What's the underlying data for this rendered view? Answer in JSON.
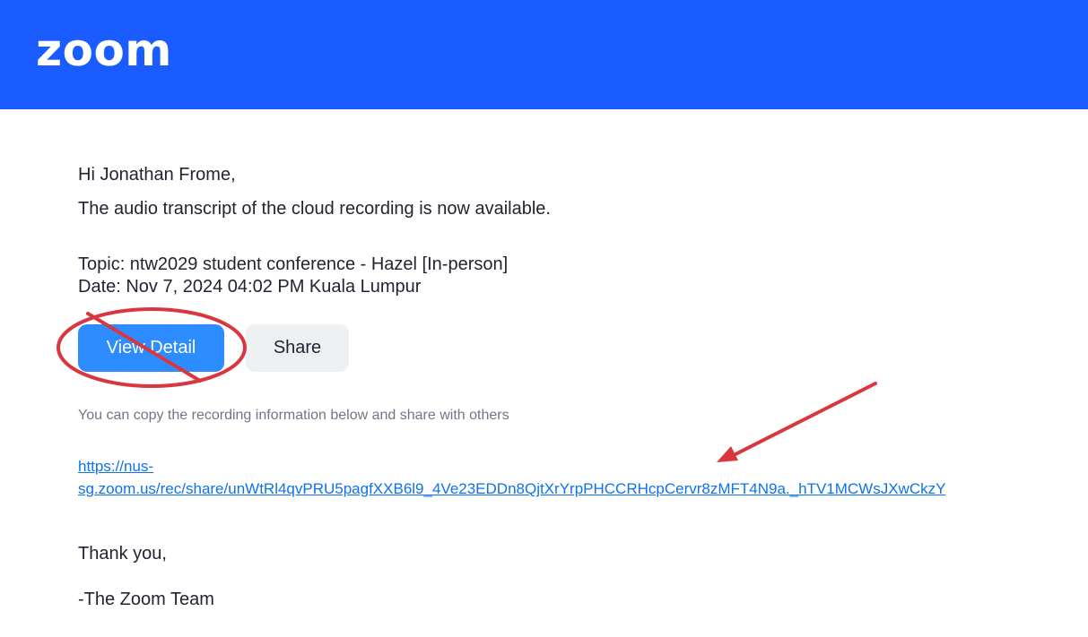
{
  "header": {
    "logo_text": "zoom",
    "background_color": "#1a5cff"
  },
  "email": {
    "greeting": "Hi Jonathan Frome,",
    "intro": "The audio transcript of the cloud recording is now available.",
    "topic_line": "Topic: ntw2029 student conference - Hazel [In-person]",
    "date_line": "Date: Nov 7, 2024 04:02 PM Kuala Lumpur",
    "buttons": {
      "view_detail_label": "View Detail",
      "share_label": "Share"
    },
    "share_note": "You can copy the recording information below and share with others",
    "share_link": {
      "line1": "https://nus-",
      "line2": "sg.zoom.us/rec/share/unWtRl4qvPRU5pagfXXB6l9_4Ve23EDDn8QjtXrYrpPHCCRHcpCervr8zMFT4N9a._hTV1MCWsJXwCkzY"
    },
    "closing": "Thank you,",
    "signature": "-The Zoom Team"
  },
  "colors": {
    "primary_button": "#2d8cff",
    "secondary_button": "#eef1f4",
    "link": "#0e72ed",
    "annotation_red": "#d9363e"
  }
}
